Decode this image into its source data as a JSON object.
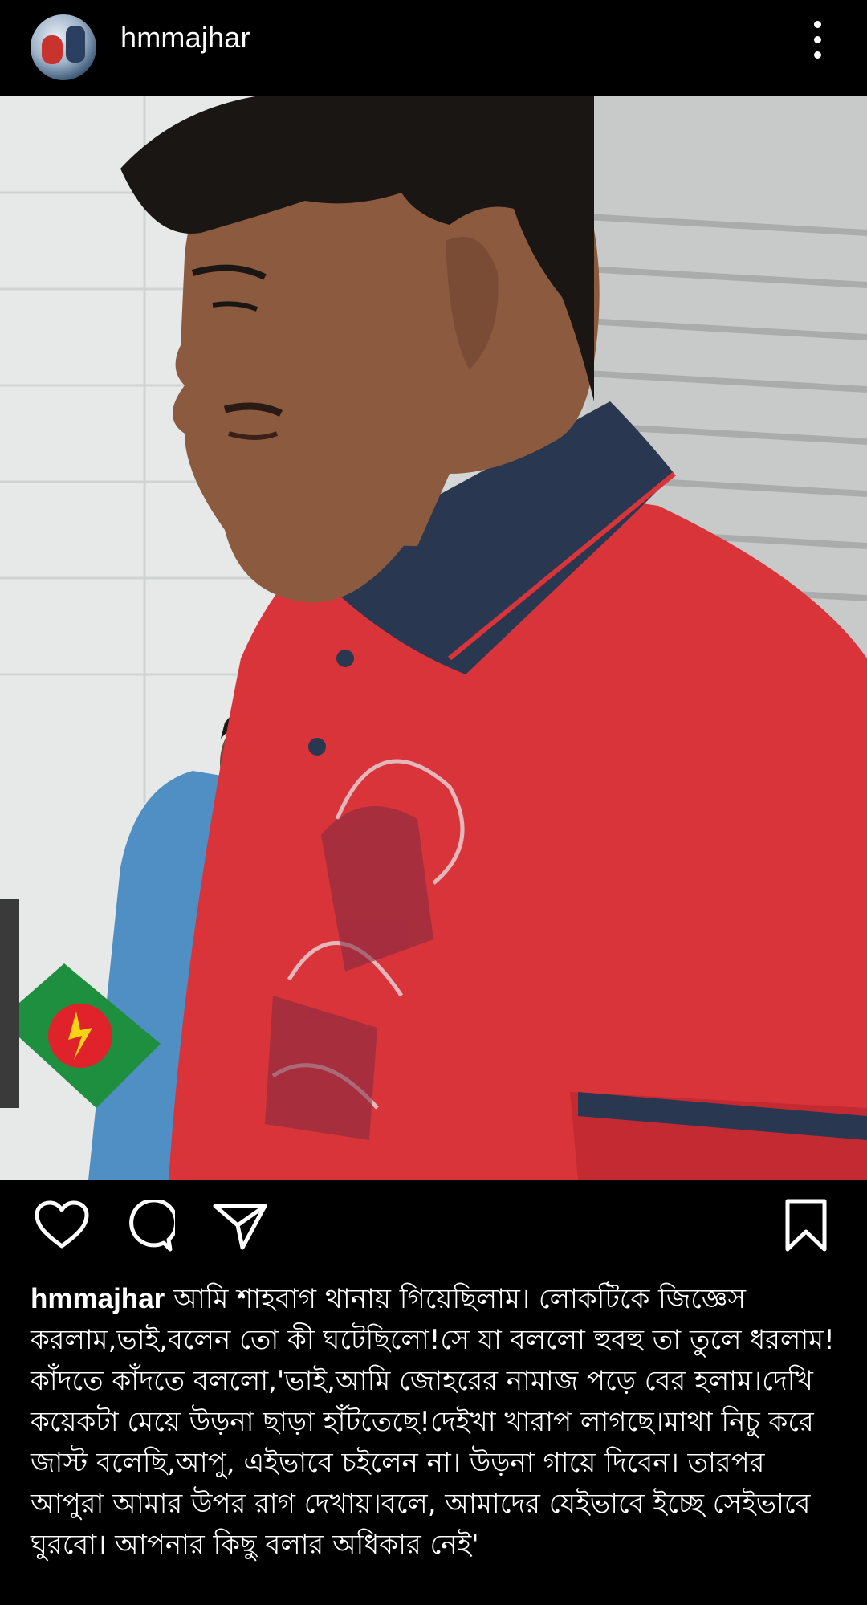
{
  "post": {
    "username": "hmmajhar",
    "caption": "আমি শাহবাগ থানায় গিয়েছিলাম। লোকটিকে জিজ্ঞেস করলাম,ভাই,বলেন তো কী ঘটেছিলো!সে যা বললো হুবহু তা তুলে ধরলাম! কাঁদতে কাঁদতে বললো,'ভাই,আমি জোহরের নামাজ পড়ে বের হলাম।দেখি কয়েকটা মেয়ে উড়না ছাড়া হাঁটতেছে!দেইখা খারাপ লাগছে।মাথা নিচু করে জাস্ট বলেছি,আপু, এইভাবে চইলেন না। উড়না গায়ে দিবেন। তারপর আপুরা আমার উপর রাগ দেখায়।বলে, আমাদের যেইভাবে ইচ্ছে সেইভাবে ঘুরবো। আপনার কিছু বলার অধিকার নেই'"
  },
  "icons": {
    "avatar": "profile-avatar",
    "more": "more-vertical-icon",
    "like": "heart-icon",
    "comment": "comment-icon",
    "share": "send-icon",
    "save": "bookmark-icon"
  },
  "colors": {
    "background": "#000000",
    "text": "#ffffff",
    "shirt": "#d9343a",
    "collar": "#2a3750"
  }
}
